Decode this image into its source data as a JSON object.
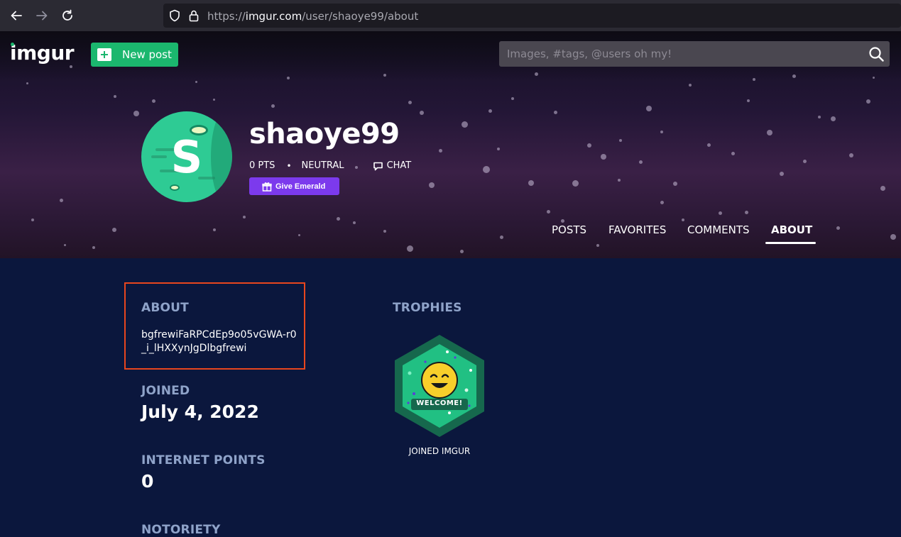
{
  "browser": {
    "url_prefix": "https://",
    "url_domain": "imgur.com",
    "url_path": "/user/shaoye99/about"
  },
  "header": {
    "logo": "imgur",
    "new_post_label": "New post",
    "search_placeholder": "Images, #tags, @users oh my!"
  },
  "profile": {
    "avatar_letter": "S",
    "username": "shaoye99",
    "points": "0 PTS",
    "separator": "•",
    "notoriety_label": "NEUTRAL",
    "chat_label": "CHAT",
    "emerald_label": "Give Emerald"
  },
  "tabs": [
    {
      "label": "POSTS"
    },
    {
      "label": "FAVORITES"
    },
    {
      "label": "COMMENTS"
    },
    {
      "label": "ABOUT",
      "active": true
    }
  ],
  "about": {
    "heading": "ABOUT",
    "text": "bgfrewiFaRPCdEp9o05vGWA-r0_i_lHXXynJgDlbgfrewi",
    "joined_heading": "JOINED",
    "joined_value": "July 4, 2022",
    "points_heading": "INTERNET POINTS",
    "points_value": "0",
    "notoriety_heading": "NOTORIETY"
  },
  "trophies": {
    "heading": "TROPHIES",
    "items": [
      {
        "badge_text": "WELCOME!",
        "label": "JOINED IMGUR"
      }
    ]
  },
  "colors": {
    "accent_green": "#1bb76e",
    "emerald_purple": "#7c3aed",
    "content_bg": "#0b173d",
    "label_color": "#8fa3c9",
    "highlight_box": "#e8461e"
  }
}
